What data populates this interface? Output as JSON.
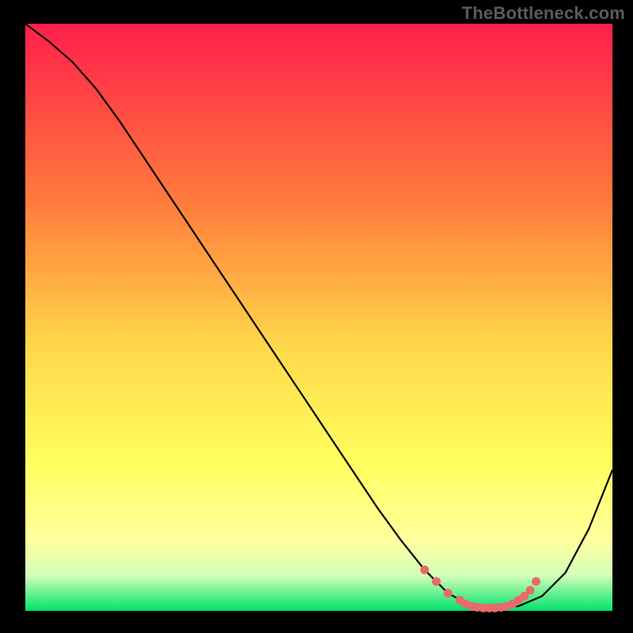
{
  "watermark": "TheBottleneck.com",
  "colors": {
    "gradient_top": "#ff1f4b",
    "gradient_mid1": "#ff7a3c",
    "gradient_mid2": "#ffd84a",
    "gradient_mid3": "#ffff60",
    "gradient_mid4": "#ffff9e",
    "gradient_mid5": "#d2ffb8",
    "gradient_bottom": "#00e36a",
    "curve_stroke": "#000000",
    "marker_stroke": "#e86a6a",
    "background": "#000000"
  },
  "chart_data": {
    "type": "line",
    "title": "",
    "xlabel": "",
    "ylabel": "",
    "xlim": [
      0,
      100
    ],
    "ylim": [
      0,
      100
    ],
    "series": [
      {
        "name": "bottleneck-curve",
        "x": [
          0,
          4,
          8,
          12,
          16,
          20,
          24,
          28,
          32,
          36,
          40,
          44,
          48,
          52,
          56,
          60,
          64,
          68,
          72,
          76,
          80,
          84,
          88,
          92,
          96,
          100
        ],
        "y": [
          100,
          97,
          93.5,
          89,
          83.5,
          77.5,
          71.5,
          65.5,
          59.5,
          53.5,
          47.5,
          41.5,
          35.5,
          29.5,
          23.5,
          17.5,
          12,
          7,
          3,
          0.8,
          0.5,
          0.8,
          2.5,
          6.5,
          14,
          24
        ]
      }
    ],
    "highlight_segment": {
      "name": "optimal-range",
      "x": [
        68,
        70,
        72,
        74,
        75,
        76,
        77,
        78,
        79,
        80,
        81,
        82,
        83,
        84,
        85,
        86,
        87
      ],
      "y": [
        7,
        5,
        3,
        1.8,
        1.2,
        0.8,
        0.6,
        0.5,
        0.5,
        0.5,
        0.6,
        0.8,
        1.2,
        1.8,
        2.5,
        3.5,
        5
      ]
    }
  }
}
